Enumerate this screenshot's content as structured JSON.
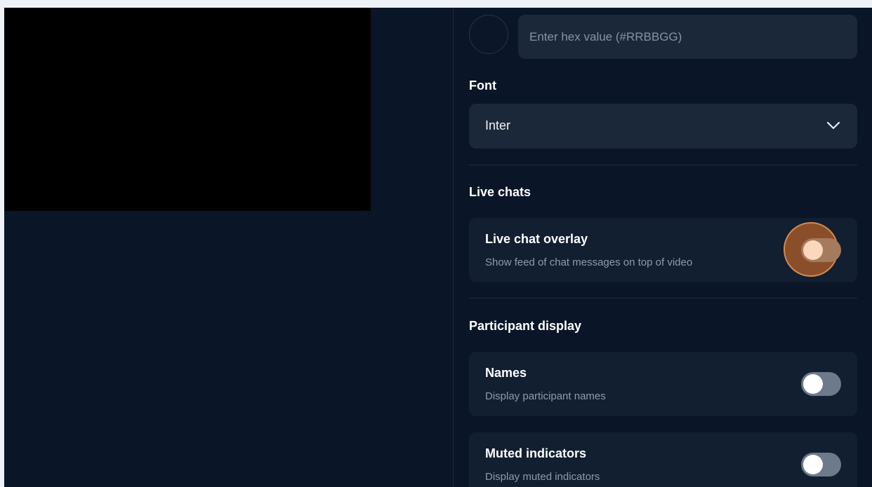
{
  "hex_input": {
    "placeholder": "Enter hex value (#RRBBGG)",
    "value": ""
  },
  "font": {
    "label": "Font",
    "selected": "Inter"
  },
  "live_chats": {
    "label": "Live chats",
    "overlay": {
      "title": "Live chat overlay",
      "description": "Show feed of chat messages on top of video",
      "enabled": false,
      "focused": true
    }
  },
  "participant_display": {
    "label": "Participant display",
    "names": {
      "title": "Names",
      "description": "Display participant names",
      "enabled": false
    },
    "muted": {
      "title": "Muted indicators",
      "description": "Display muted indicators",
      "enabled": false
    }
  },
  "colors": {
    "background": "#0a1628",
    "card": "#111f31",
    "input": "#1b2839",
    "focus_ring": "#d88a4e",
    "toggle_off": "#6d7a8b"
  }
}
